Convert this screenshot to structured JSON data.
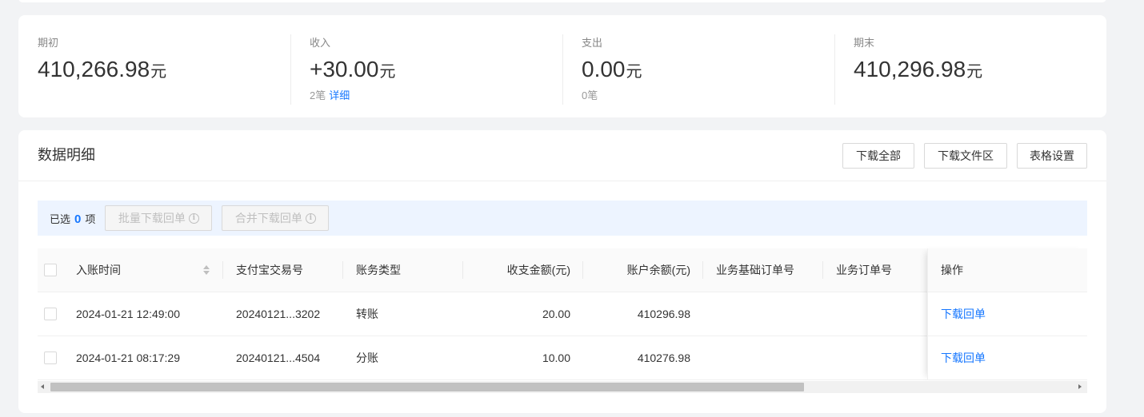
{
  "summary": {
    "items": [
      {
        "label": "期初",
        "value": "410,266.98",
        "unit": "元"
      },
      {
        "label": "收入",
        "value": "+30.00",
        "unit": "元",
        "count": "2笔",
        "link": "详细"
      },
      {
        "label": "支出",
        "value": "0.00",
        "unit": "元",
        "count": "0笔"
      },
      {
        "label": "期末",
        "value": "410,296.98",
        "unit": "元"
      }
    ]
  },
  "detail": {
    "title": "数据明细",
    "actions": {
      "download_all": "下载全部",
      "download_files": "下载文件区",
      "table_settings": "表格设置"
    },
    "selection": {
      "prefix": "已选",
      "count": "0",
      "suffix": "项",
      "batch_download": "批量下载回单",
      "merge_download": "合并下载回单"
    },
    "table": {
      "columns": {
        "time": "入账时间",
        "trade_no": "支付宝交易号",
        "type": "账务类型",
        "amount": "收支金额(元)",
        "balance": "账户余额(元)",
        "base_order": "业务基础订单号",
        "order": "业务订单号",
        "action": "操作"
      },
      "rows": [
        {
          "time": "2024-01-21 12:49:00",
          "trade_no": "20240121...3202",
          "type": "转账",
          "amount": "20.00",
          "balance": "410296.98",
          "action": "下载回单"
        },
        {
          "time": "2024-01-21 08:17:29",
          "trade_no": "20240121...4504",
          "type": "分账",
          "amount": "10.00",
          "balance": "410276.98",
          "action": "下载回单"
        }
      ]
    }
  },
  "icons": {
    "sort": "sort-icon",
    "info": "info-icon",
    "scroll_left": "arrow-left-icon",
    "scroll_right": "arrow-right-icon"
  },
  "colors": {
    "accent": "#1677ff",
    "selection_bar": "#edf4ff",
    "text": "#333333",
    "muted": "#999999",
    "page_bg": "#f2f3f5"
  }
}
